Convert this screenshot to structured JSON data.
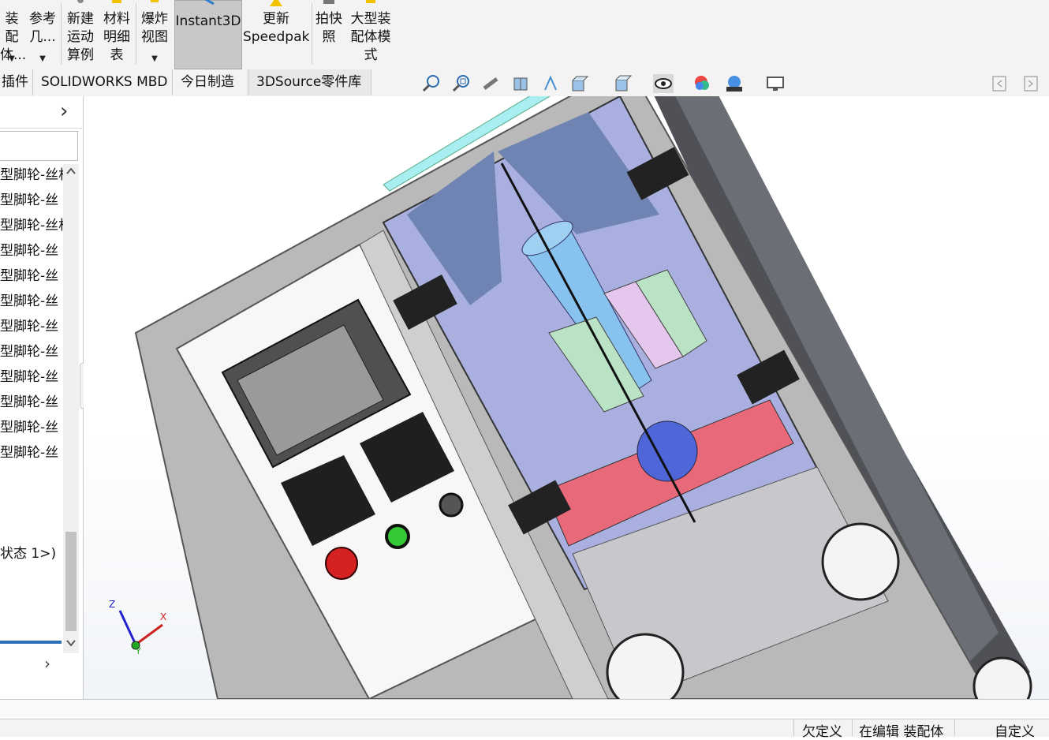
{
  "ribbon": {
    "buttons": [
      {
        "label": "装配\n体...",
        "id": "assembly"
      },
      {
        "label": "参考\n几...",
        "id": "reference-geometry"
      },
      {
        "label": "新建\n运动\n算例",
        "id": "new-motion-study"
      },
      {
        "label": "材料\n明细\n表",
        "id": "bill-of-materials"
      },
      {
        "label": "爆炸\n视图",
        "id": "exploded-view"
      },
      {
        "label": "Instant3D",
        "id": "instant3d"
      },
      {
        "label": "更新\nSpeedpak",
        "id": "update-speedpak"
      },
      {
        "label": "拍快\n照",
        "id": "snapshot"
      },
      {
        "label": "大型装\n配体模\n式",
        "id": "large-assembly-mode"
      }
    ],
    "dropdown_glyph": "▼"
  },
  "tabs": [
    "插件",
    "SOLIDWORKS MBD",
    "今日制造",
    "3DSource零件库"
  ],
  "heads_up_toolbar": {
    "icons": [
      "zoom-to-fit-icon",
      "zoom-to-area-icon",
      "previous-view-icon",
      "section-view-icon",
      "dynamic-annotation-icon",
      "view-orientation-icon",
      "display-style-icon",
      "hide-show-icon",
      "edit-appearance-icon",
      "apply-scene-icon",
      "view-settings-icon"
    ]
  },
  "left_panel": {
    "expand_glyph": "›",
    "tree_items": [
      "型脚轮-丝杆",
      "型脚轮-丝",
      "型脚轮-丝杆",
      "型脚轮-丝",
      "型脚轮-丝",
      "型脚轮-丝",
      "型脚轮-丝",
      "型脚轮-丝",
      "型脚轮-丝",
      "型脚轮-丝",
      "型脚轮-丝",
      "型脚轮-丝"
    ],
    "config_label": "状态 1>)"
  },
  "triad": {
    "x": "X",
    "y": "Y",
    "z": "Z"
  },
  "status_bar": {
    "items": [
      "欠定义",
      "在编辑 装配体",
      "自定义"
    ]
  },
  "colors": {
    "frame": "#b5b5b5",
    "glass": "#a9b0e0",
    "panel_red": "#e86a7a",
    "accent_green": "#37c837",
    "estop_red": "#d42222"
  }
}
